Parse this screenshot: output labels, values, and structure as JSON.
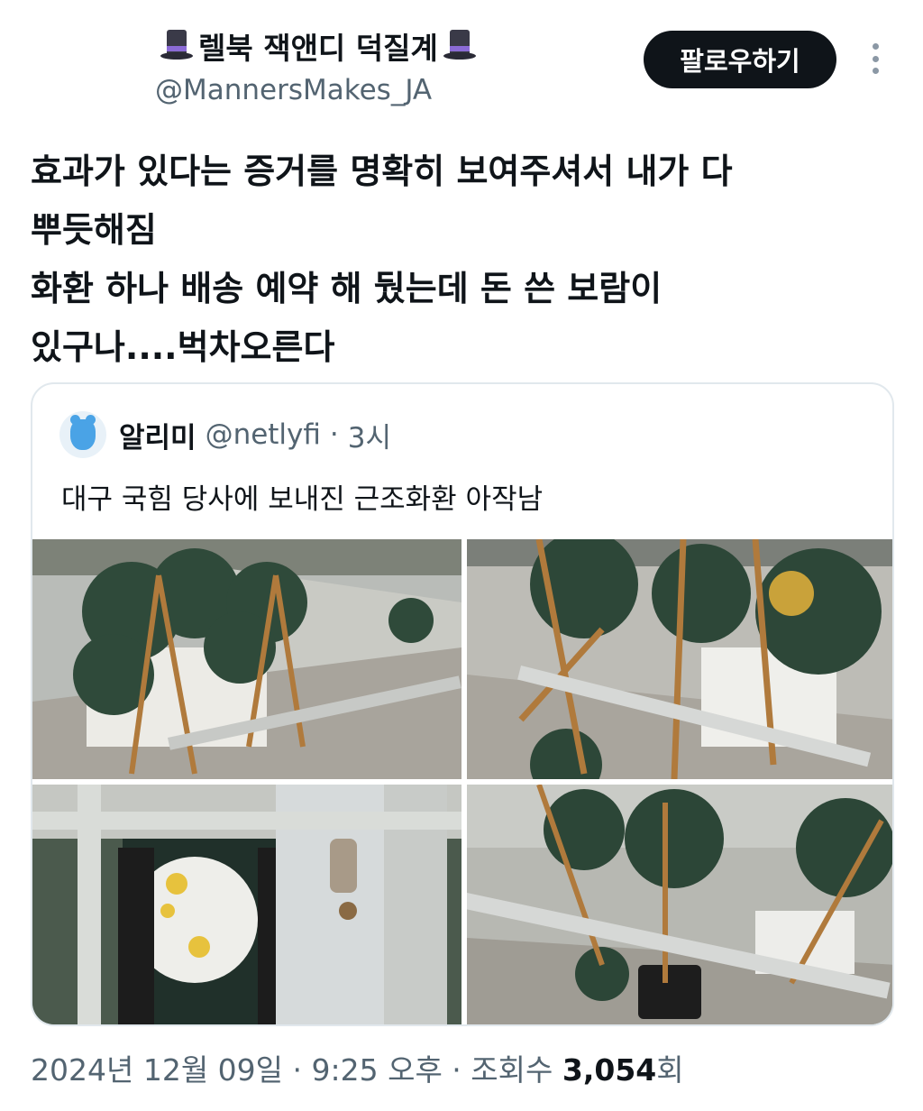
{
  "author": {
    "display_name": "렐북 잭앤디 덕질계",
    "handle": "@MannersMakes_JA",
    "name_emoji": "top-hat-icon"
  },
  "actions": {
    "follow_label": "팔로우하기",
    "more_icon": "more-vertical-icon"
  },
  "tweet": {
    "lines": [
      "효과가 있다는 증거를 명확히 보여주셔서 내가 다",
      "뿌듯해짐",
      "화환 하나 배송 예약 해 뒀는데 돈 쓴 보람이",
      "있구나....벅차오른다"
    ]
  },
  "quote": {
    "name": "알리미",
    "handle": "@netlyfi",
    "separator": "·",
    "time": "3시",
    "text": "대구 국힘 당사에 보내진 근조화환 아작남",
    "avatar_icon": "bear-avatar-icon",
    "photos": [
      "funeral-wreaths-along-wall-photo",
      "broken-wreaths-closeup-photo",
      "wreath-behind-gate-photo",
      "fallen-wreaths-photo"
    ]
  },
  "meta": {
    "timestamp": "2024년 12월 09일 · 9:25 오후 · 조회수",
    "views_count": "3,054",
    "views_suffix": "회"
  },
  "colors": {
    "text_primary": "#0f1419",
    "text_secondary": "#536471",
    "follow_button_bg": "#0f1419",
    "follow_button_text": "#ffffff",
    "border": "#e1e8ed"
  }
}
